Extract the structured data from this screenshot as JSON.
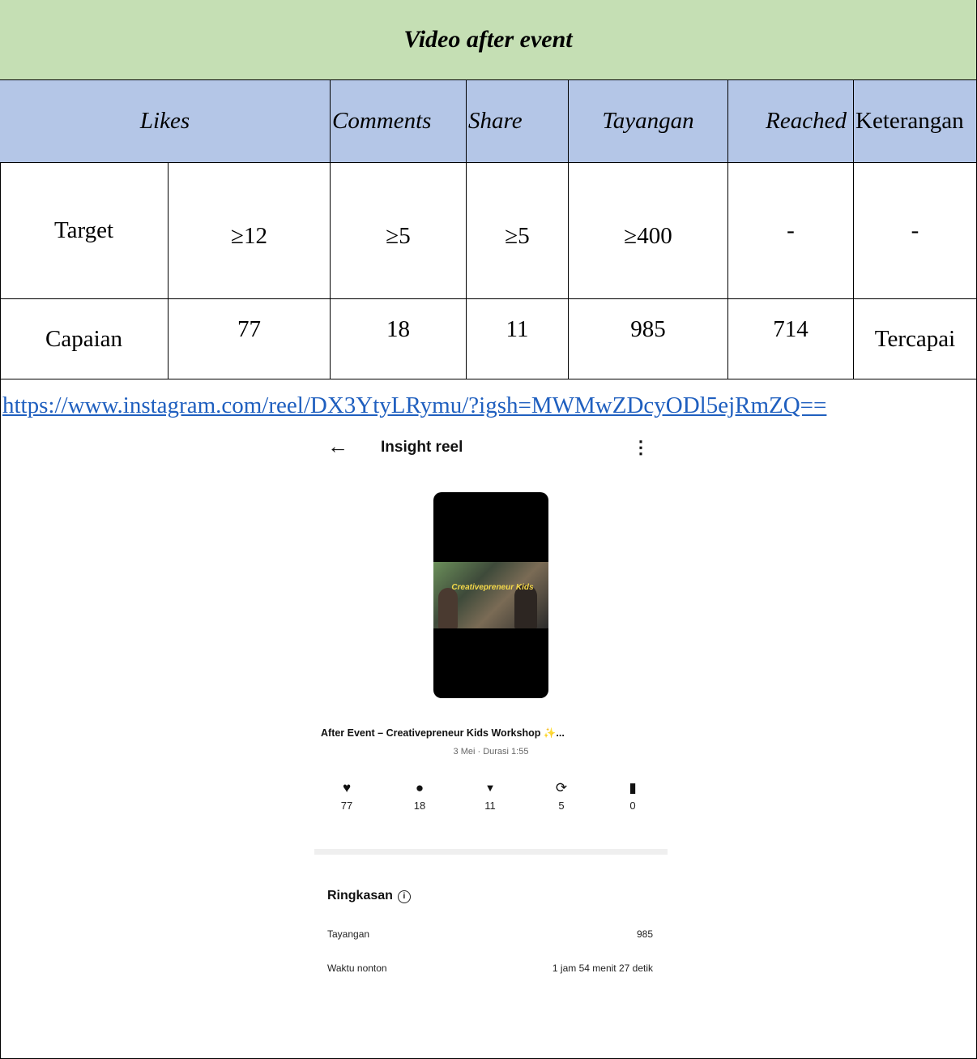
{
  "table": {
    "title": "Video after event",
    "headers": [
      "Likes",
      "Comments",
      "Share",
      "Tayangan",
      "Reached",
      "Keterangan"
    ],
    "rows": [
      {
        "label": "Target",
        "values": [
          "≥12",
          "≥5",
          "≥5",
          "≥400",
          "-",
          "-"
        ]
      },
      {
        "label": "Capaian",
        "values": [
          "77",
          "18",
          "11",
          "985",
          "714",
          "Tercapai"
        ]
      }
    ]
  },
  "link": "https://www.instagram.com/reel/DX3YtyLRymu/?igsh=MWMwZDcyODl5ejRmZQ==",
  "screenshot": {
    "header_title": "Insight reel",
    "back_icon": "←",
    "more_icon": "⋮",
    "thumbnail_text": "Creativepreneur Kids",
    "reel_title": "After Event – Creativepreneur Kids Workshop ✨...",
    "reel_meta": "3 Mei · Durasi 1:55",
    "stats": [
      {
        "icon": "heart-icon",
        "glyph": "♥",
        "value": "77"
      },
      {
        "icon": "comment-icon",
        "glyph": "●",
        "value": "18"
      },
      {
        "icon": "share-icon",
        "glyph": "▼",
        "value": "11"
      },
      {
        "icon": "repost-icon",
        "glyph": "⟳",
        "value": "5"
      },
      {
        "icon": "bookmark-icon",
        "glyph": "▮",
        "value": "0"
      }
    ],
    "summary_title": "Ringkasan",
    "info_glyph": "i",
    "summary_rows": [
      {
        "label": "Tayangan",
        "value": "985"
      },
      {
        "label": "Waktu nonton",
        "value": "1 jam 54 menit 27 detik"
      }
    ]
  }
}
